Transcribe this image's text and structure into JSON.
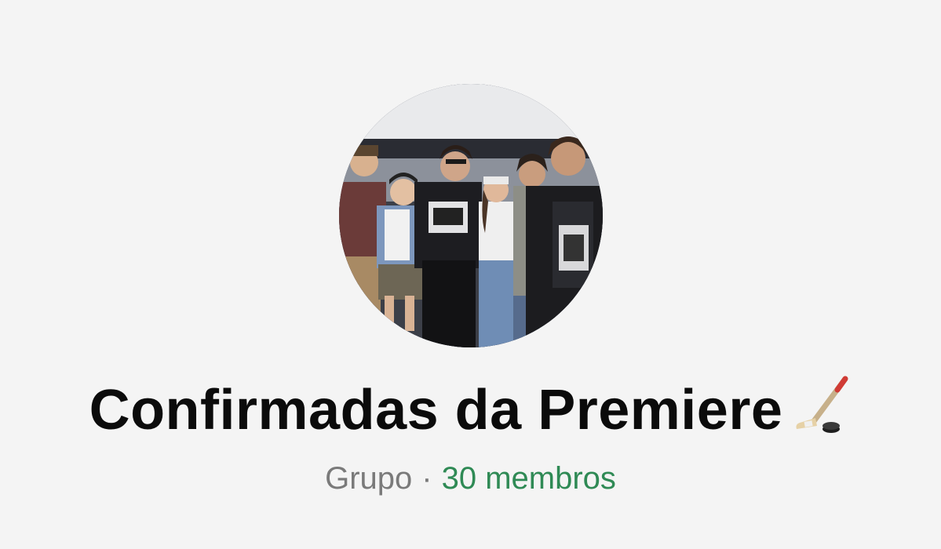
{
  "group": {
    "title": "Confirmadas da Premiere",
    "title_emoji": "hockey-stick-and-puck-icon",
    "type_label": "Grupo",
    "separator": "·",
    "member_count_label": "30 membros"
  },
  "avatar": {
    "description_icon": "group-photo-avatar"
  },
  "colors": {
    "background": "#f4f4f4",
    "title": "#0b0b0b",
    "muted": "#7a7a7a",
    "accent_green": "#2f8a55"
  }
}
